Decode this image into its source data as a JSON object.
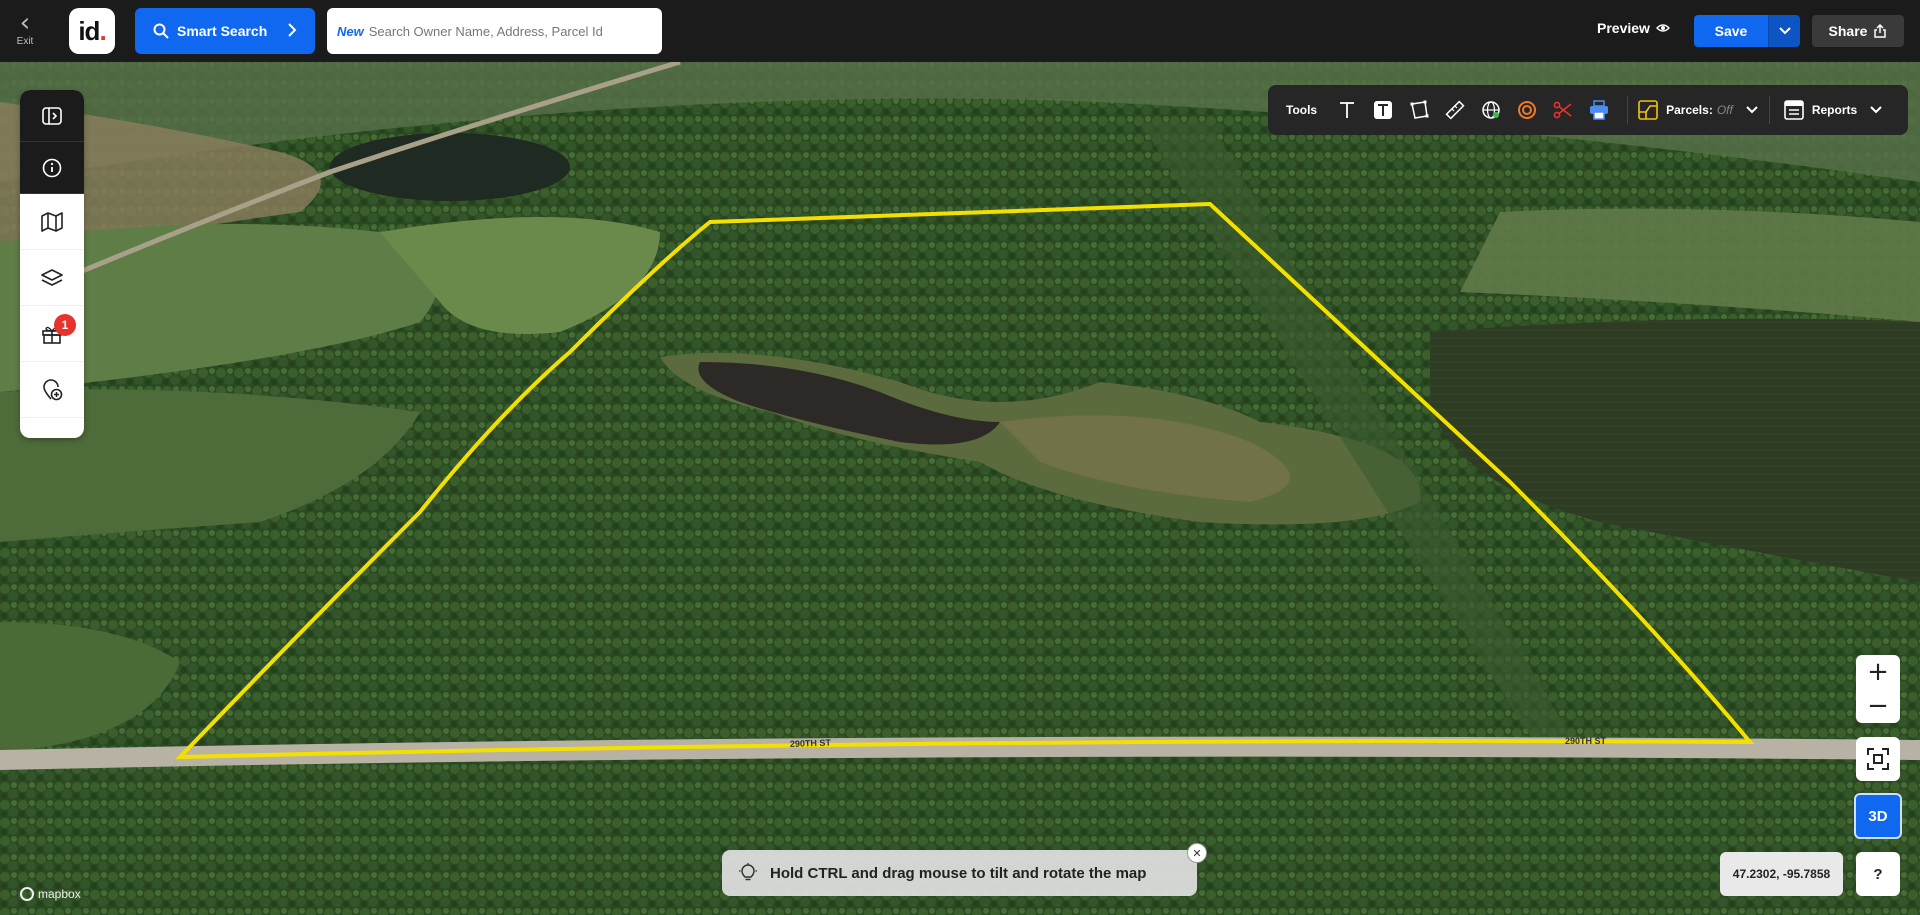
{
  "header": {
    "exit_label": "Exit",
    "logo_text": "id",
    "smart_search_label": "Smart Search",
    "search_new_tag": "New",
    "search_placeholder": "Search Owner Name, Address, Parcel Id",
    "preview_label": "Preview",
    "save_label": "Save",
    "share_label": "Share"
  },
  "sidebar": {
    "icons": [
      "toggle-panel-icon",
      "info-icon",
      "map-icon",
      "layers-icon",
      "gift-icon",
      "add-location-icon"
    ],
    "gift_badge": "1"
  },
  "toolbar": {
    "tools_label": "Tools",
    "parcels_label": "Parcels:",
    "parcels_state": "Off",
    "reports_label": "Reports"
  },
  "map": {
    "road_label_1": "290TH ST",
    "road_label_2": "290TH ST",
    "attribution": "mapbox",
    "parcel_outline_color": "#f4e000"
  },
  "controls": {
    "zoom_in": "+",
    "zoom_out": "−",
    "mode_3d": "3D",
    "coordinates": "47.2302, -95.7858",
    "help": "?"
  },
  "hint": {
    "text": "Hold CTRL and drag mouse to tilt and rotate the map",
    "close": "✕"
  },
  "colors": {
    "accent": "#1068f0",
    "topbar": "#1b1b1b",
    "badge": "#e8322d"
  }
}
